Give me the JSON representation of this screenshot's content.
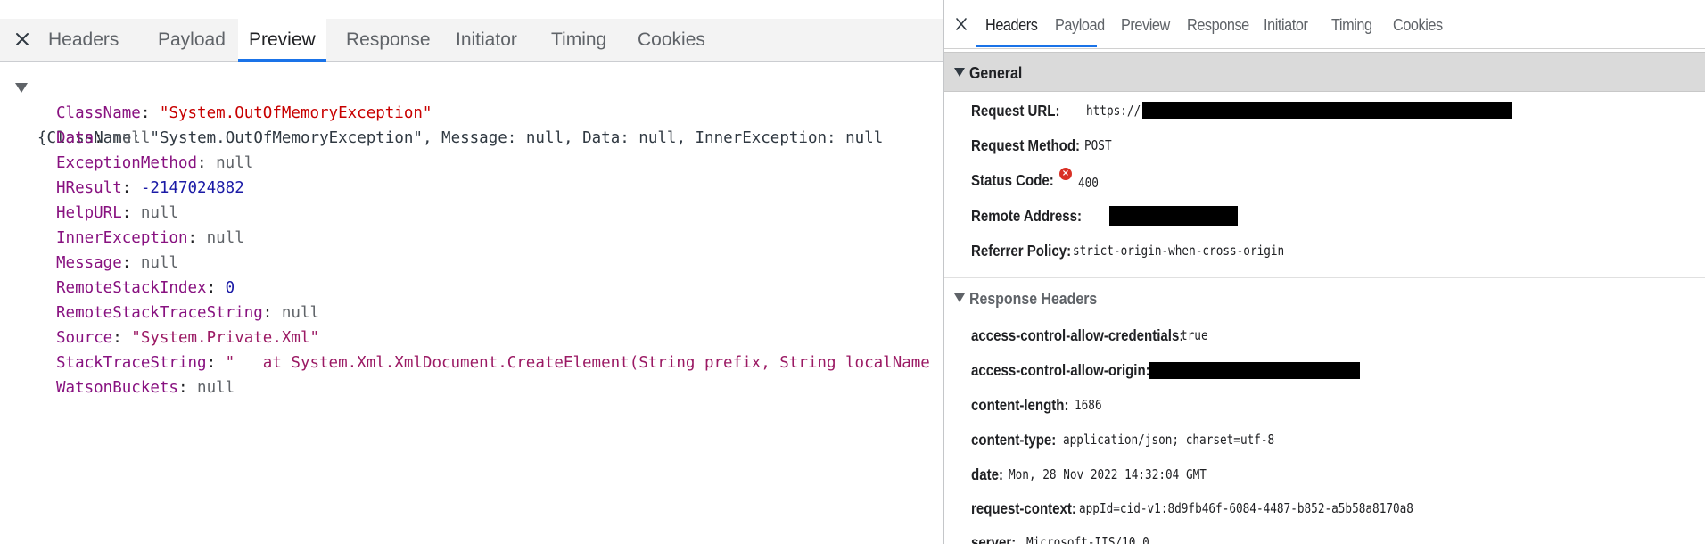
{
  "left": {
    "tabs": [
      {
        "label": "Headers"
      },
      {
        "label": "Payload"
      },
      {
        "label": "Preview"
      },
      {
        "label": "Response"
      },
      {
        "label": "Initiator"
      },
      {
        "label": "Timing"
      },
      {
        "label": "Cookies"
      }
    ],
    "active_tab": "Preview",
    "summary": "{ClassName: \"System.OutOfMemoryException\", Message: null, Data: null, InnerException: null",
    "fields": [
      {
        "key": "ClassName",
        "value": "\"System.OutOfMemoryException\"",
        "kind": "string"
      },
      {
        "key": "Data",
        "value": "null",
        "kind": "null"
      },
      {
        "key": "ExceptionMethod",
        "value": "null",
        "kind": "null"
      },
      {
        "key": "HResult",
        "value": "-2147024882",
        "kind": "number"
      },
      {
        "key": "HelpURL",
        "value": "null",
        "kind": "null"
      },
      {
        "key": "InnerException",
        "value": "null",
        "kind": "null"
      },
      {
        "key": "Message",
        "value": "null",
        "kind": "null"
      },
      {
        "key": "RemoteStackIndex",
        "value": "0",
        "kind": "number"
      },
      {
        "key": "RemoteStackTraceString",
        "value": "null",
        "kind": "null"
      },
      {
        "key": "Source",
        "value": "\"System.Private.Xml\"",
        "kind": "string"
      },
      {
        "key": "StackTraceString",
        "value": "\"   at System.Xml.XmlDocument.CreateElement(String prefix, String localName",
        "kind": "string2"
      },
      {
        "key": "WatsonBuckets",
        "value": "null",
        "kind": "null"
      }
    ]
  },
  "right": {
    "tabs": [
      {
        "label": "Headers"
      },
      {
        "label": "Payload"
      },
      {
        "label": "Preview"
      },
      {
        "label": "Response"
      },
      {
        "label": "Initiator"
      },
      {
        "label": "Timing"
      },
      {
        "label": "Cookies"
      }
    ],
    "active_tab": "Headers",
    "general": {
      "title": "General",
      "request_url_label": "Request URL:",
      "request_url_prefix": "https://",
      "request_method_label": "Request Method:",
      "request_method": "POST",
      "status_code_label": "Status Code:",
      "status_code": "400",
      "remote_address_label": "Remote Address:",
      "referrer_policy_label": "Referrer Policy:",
      "referrer_policy": "strict-origin-when-cross-origin"
    },
    "response_headers": {
      "title": "Response Headers",
      "items": [
        {
          "name": "access-control-allow-credentials:",
          "value": "true"
        },
        {
          "name": "access-control-allow-origin:",
          "value": ""
        },
        {
          "name": "content-length:",
          "value": "1686"
        },
        {
          "name": "content-type:",
          "value": "application/json; charset=utf-8"
        },
        {
          "name": "date:",
          "value": "Mon, 28 Nov 2022 14:32:04 GMT"
        },
        {
          "name": "request-context:",
          "value": "appId=cid-v1:8d9fb46f-6084-4487-b852-a5b58a8170a8"
        },
        {
          "name": "server:",
          "value": "Microsoft-IIS/10.0"
        }
      ]
    }
  }
}
